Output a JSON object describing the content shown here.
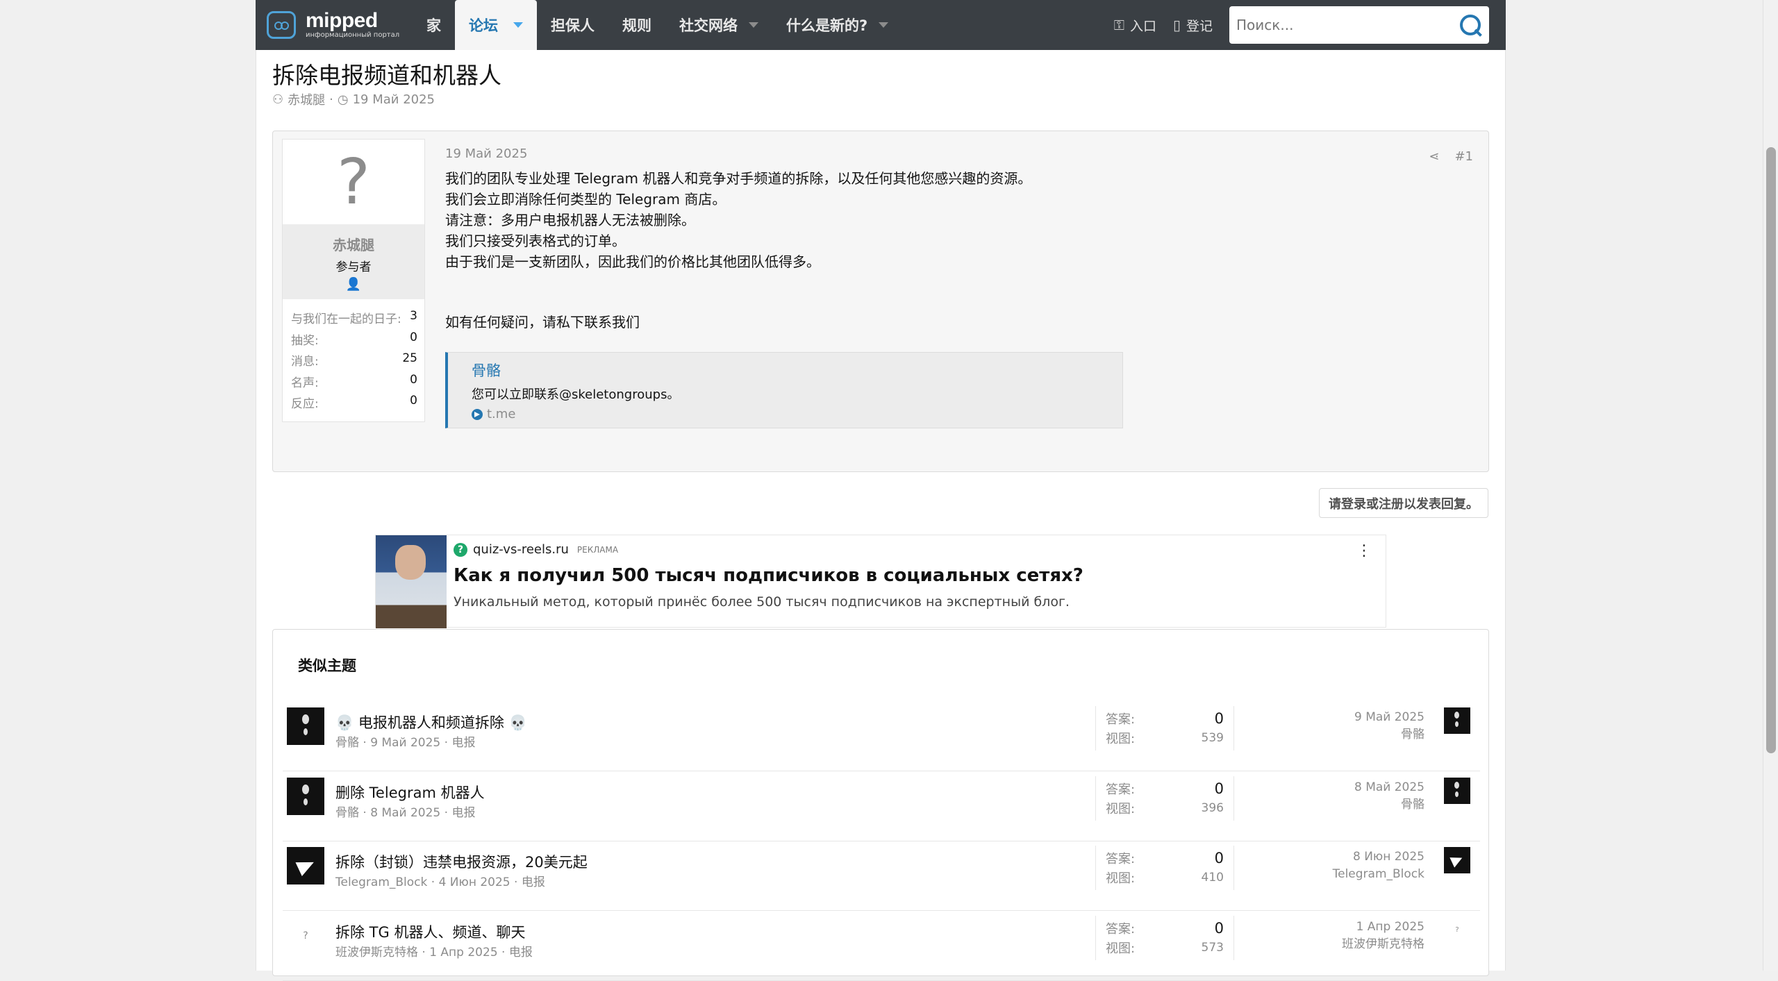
{
  "nav": {
    "logo_main": "mipped",
    "logo_sub": "информационный портал",
    "tabs": [
      {
        "label": "家"
      },
      {
        "label": "论坛"
      },
      {
        "label": "担保人"
      },
      {
        "label": "规则"
      },
      {
        "label": "社交网络"
      },
      {
        "label": "什么是新的?"
      }
    ],
    "login_label": "入口",
    "register_label": "登记",
    "search_placeholder": "Поиск..."
  },
  "thread": {
    "title": "拆除电报频道和机器人",
    "author": "赤城腿",
    "date": "19 Май 2025"
  },
  "post": {
    "date": "19 Май 2025",
    "number": "#1",
    "lines": [
      "我们的团队专业处理 Telegram 机器人和竞争对手频道的拆除，以及任何其他您感兴趣的资源。",
      "我们会立即消除任何类型的 Telegram 商店。",
      "请注意：多用户电报机器人无法被删除。",
      "我们只接受列表格式的订单。",
      "由于我们是一支新团队，因此我们的价格比其他团队低得多。"
    ],
    "closing": "如有任何疑问，请私下联系我们",
    "embed": {
      "title": "骨骼",
      "desc": "您可以立即联系@skeletongroups。",
      "source": "t.me"
    }
  },
  "user": {
    "avatar_glyph": "?",
    "name": "赤城腿",
    "role": "参与者",
    "stats": [
      {
        "label": "与我们在一起的日子:",
        "value": "3"
      },
      {
        "label": "抽奖:",
        "value": "0"
      },
      {
        "label": "消息:",
        "value": "25"
      },
      {
        "label": "名声:",
        "value": "0"
      },
      {
        "label": "反应:",
        "value": "0"
      }
    ]
  },
  "reply_button": "请登录或注册以发表回复。",
  "ad": {
    "host": "quiz-vs-reels.ru",
    "tag": "РЕКЛАМА",
    "headline": "Как я получил 500 тысяч подписчиков в социальных сетях?",
    "desc": "Уникальный метод, который принёс более 500 тысяч подписчиков на экспертный блог."
  },
  "similar": {
    "title": "类似主题",
    "replies_label": "答案:",
    "views_label": "视图:",
    "threads": [
      {
        "title": "💀 电报机器人和频道拆除 💀",
        "meta": "骨骼 · 9 Май 2025 · 电报",
        "replies": "0",
        "views": "539",
        "last_date": "9 Май 2025",
        "last_user": "骨骼"
      },
      {
        "title": "删除 Telegram 机器人",
        "meta": "骨骼 · 8 Май 2025 · 电报",
        "replies": "0",
        "views": "396",
        "last_date": "8 Май 2025",
        "last_user": "骨骼"
      },
      {
        "title": "拆除（封锁）违禁电报资源，20美元起",
        "meta": "Telegram_Block · 4 Июн 2025 · 电报",
        "replies": "0",
        "views": "410",
        "last_date": "8 Июн 2025",
        "last_user": "Telegram_Block"
      },
      {
        "title": "拆除 TG 机器人、频道、聊天",
        "meta": "班波伊斯克特格 · 1 Апр 2025 · 电报",
        "replies": "0",
        "views": "573",
        "last_date": "1 Апр 2025",
        "last_user": "班波伊斯克特格"
      }
    ]
  }
}
